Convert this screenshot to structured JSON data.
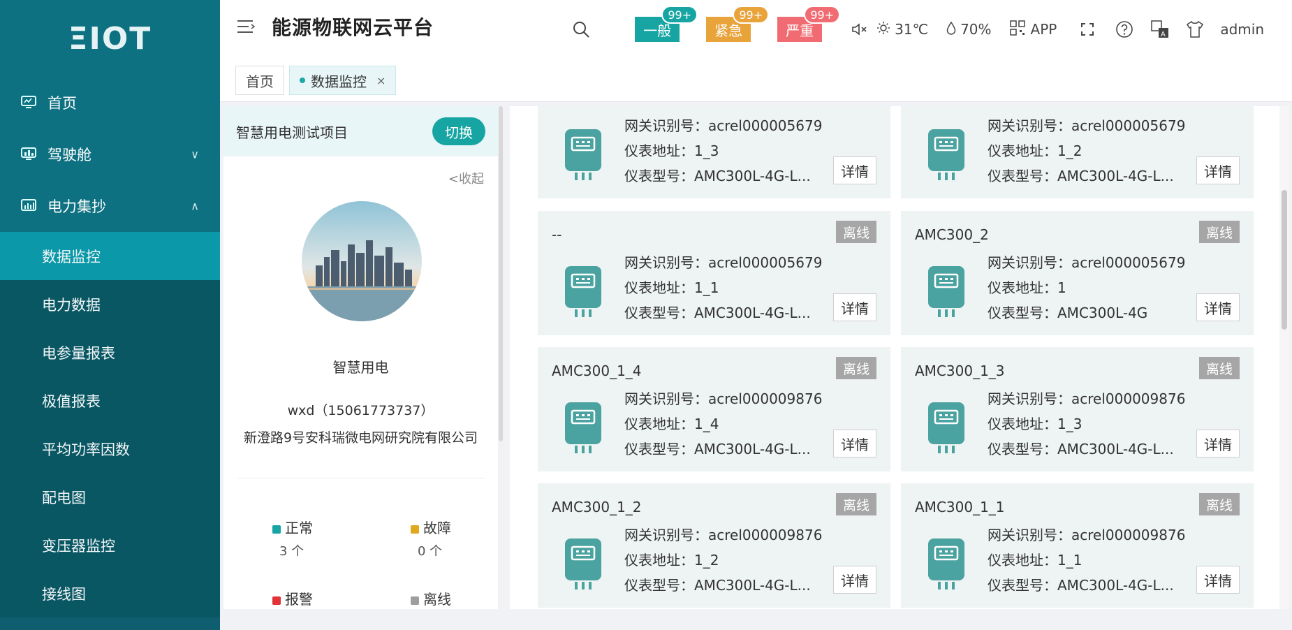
{
  "sidebar": {
    "logo": "ΞIOT",
    "items": [
      {
        "label": "首页",
        "icon": "monitor-icon"
      },
      {
        "label": "驾驶舱",
        "icon": "dashboard-icon",
        "expandable": true
      },
      {
        "label": "电力集抄",
        "icon": "chart-icon",
        "expanded": true
      }
    ],
    "subitems": [
      {
        "label": "数据监控",
        "active": true
      },
      {
        "label": "电力数据"
      },
      {
        "label": "电参量报表"
      },
      {
        "label": "极值报表"
      },
      {
        "label": "平均功率因数"
      },
      {
        "label": "配电图"
      },
      {
        "label": "变压器监控"
      },
      {
        "label": "接线图"
      }
    ]
  },
  "header": {
    "title": "能源物联网云平台",
    "alarms": [
      {
        "label": "一般",
        "count": "99+",
        "color": "#17a5a3"
      },
      {
        "label": "紧急",
        "count": "99+",
        "color": "#e8a33b"
      },
      {
        "label": "严重",
        "count": "99+",
        "color": "#f16c72"
      }
    ],
    "temperature": "31℃",
    "humidity": "70%",
    "app_label": "APP",
    "user": "admin"
  },
  "tabs": [
    {
      "label": "首页"
    },
    {
      "label": "数据监控",
      "active": true
    }
  ],
  "project": {
    "name": "智慧用电测试项目",
    "switch_label": "切换",
    "collapse_label": "<收起",
    "title": "智慧用电",
    "contact": "wxd（15061773737）",
    "address": "新澄路9号安科瑞微电网研究院有限公司",
    "stats": [
      {
        "label": "正常",
        "count": "3 个",
        "color": "#17a5a3"
      },
      {
        "label": "故障",
        "count": "0 个",
        "color": "#e0a81e"
      },
      {
        "label": "报警",
        "count": "",
        "color": "#e2323a"
      },
      {
        "label": "离线",
        "count": "",
        "color": "#9e9e9e"
      }
    ]
  },
  "labels": {
    "gateway": "网关识别号：",
    "address": "仪表地址：",
    "model": "仪表型号：",
    "detail": "详情"
  },
  "devices": [
    {
      "title": "",
      "status": "",
      "gateway": "acrel000005679",
      "address": "1_3",
      "model": "AMC300L-4G-L..."
    },
    {
      "title": "",
      "status": "",
      "gateway": "acrel000005679",
      "address": "1_2",
      "model": "AMC300L-4G-L..."
    },
    {
      "title": "--",
      "status": "离线",
      "gateway": "acrel000005679",
      "address": "1_1",
      "model": "AMC300L-4G-L..."
    },
    {
      "title": "AMC300_2",
      "status": "离线",
      "gateway": "acrel000005679",
      "address": "1",
      "model": "AMC300L-4G"
    },
    {
      "title": "AMC300_1_4",
      "status": "离线",
      "gateway": "acrel000009876",
      "address": "1_4",
      "model": "AMC300L-4G-L..."
    },
    {
      "title": "AMC300_1_3",
      "status": "离线",
      "gateway": "acrel000009876",
      "address": "1_3",
      "model": "AMC300L-4G-L..."
    },
    {
      "title": "AMC300_1_2",
      "status": "离线",
      "gateway": "acrel000009876",
      "address": "1_2",
      "model": "AMC300L-4G-L..."
    },
    {
      "title": "AMC300_1_1",
      "status": "离线",
      "gateway": "acrel000009876",
      "address": "1_1",
      "model": "AMC300L-4G-L..."
    }
  ]
}
